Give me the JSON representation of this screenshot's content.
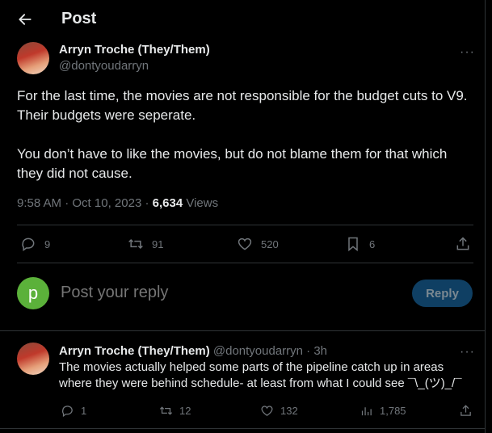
{
  "header": {
    "title": "Post",
    "back_icon": "arrow-left-icon"
  },
  "post": {
    "author_name": "Arryn Troche (They/Them)",
    "author_handle": "@dontyoudarryn",
    "paragraphs": [
      "For the last time, the movies are not responsible for the budget cuts to V9. Their budgets were seperate.",
      "You don’t have to like the movies, but do not blame them for that which they did not cause."
    ],
    "time": "9:58 AM",
    "date": "Oct 10, 2023",
    "views": "6,634",
    "views_label": "Views",
    "more_label": "···",
    "stats": {
      "replies": "9",
      "reposts": "91",
      "likes": "520",
      "bookmarks": "6"
    }
  },
  "composer": {
    "avatar_letter": "p",
    "placeholder": "Post your reply",
    "button_label": "Reply",
    "avatar_color": "#5bb13a"
  },
  "reply": {
    "author_name": "Arryn Troche (They/Them)",
    "author_handle": "@dontyoudarryn",
    "separator": "·",
    "time": "3h",
    "text": "The movies actually helped some parts of the pipeline catch up in areas where they were behind schedule- at least from what I could see ¯\\_(ツ)_/¯",
    "more_label": "···",
    "stats": {
      "replies": "1",
      "reposts": "12",
      "likes": "132",
      "views": "1,785"
    }
  },
  "colors": {
    "background": "#000000",
    "text": "#e7e9ea",
    "muted": "#71767b",
    "divider": "#2f3336",
    "reply_button": "#0f3f63"
  }
}
